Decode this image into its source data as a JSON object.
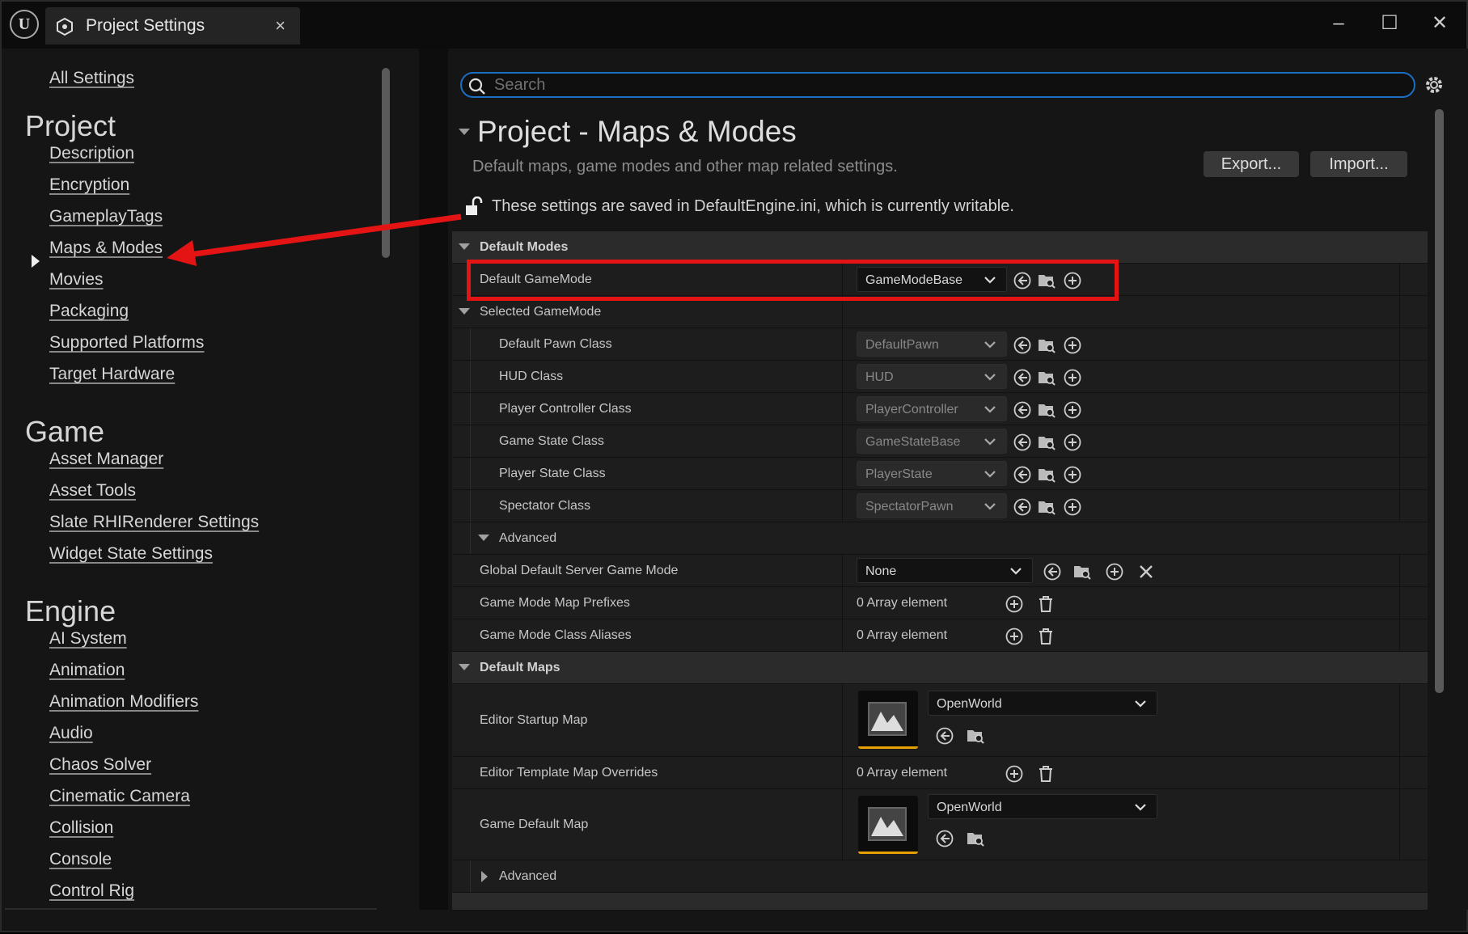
{
  "window": {
    "title": "Project Settings"
  },
  "sidebar": {
    "all_settings": "All Settings",
    "project_heading": "Project",
    "project_items": [
      "Description",
      "Encryption",
      "GameplayTags",
      "Maps & Modes",
      "Movies",
      "Packaging",
      "Supported Platforms",
      "Target Hardware"
    ],
    "game_heading": "Game",
    "game_items": [
      "Asset Manager",
      "Asset Tools",
      "Slate RHIRenderer Settings",
      "Widget State Settings"
    ],
    "engine_heading": "Engine",
    "engine_items": [
      "AI System",
      "Animation",
      "Animation Modifiers",
      "Audio",
      "Chaos Solver",
      "Cinematic Camera",
      "Collision",
      "Console",
      "Control Rig"
    ]
  },
  "search": {
    "placeholder": "Search"
  },
  "header": {
    "title": "Project - Maps & Modes",
    "description": "Default maps, game modes and other map related settings.",
    "export_label": "Export...",
    "import_label": "Import...",
    "config_notice": "These settings are saved in DefaultEngine.ini, which is currently writable."
  },
  "sections": {
    "default_modes": "Default Modes",
    "default_gamemode_label": "Default GameMode",
    "default_gamemode_value": "GameModeBase",
    "selected_gamemode": "Selected GameMode",
    "class_rows": [
      {
        "label": "Default Pawn Class",
        "value": "DefaultPawn"
      },
      {
        "label": "HUD Class",
        "value": "HUD"
      },
      {
        "label": "Player Controller Class",
        "value": "PlayerController"
      },
      {
        "label": "Game State Class",
        "value": "GameStateBase"
      },
      {
        "label": "Player State Class",
        "value": "PlayerState"
      },
      {
        "label": "Spectator Class",
        "value": "SpectatorPawn"
      }
    ],
    "advanced": "Advanced",
    "global_server_label": "Global Default Server Game Mode",
    "global_server_value": "None",
    "map_prefixes_label": "Game Mode Map Prefixes",
    "map_prefixes_value": "0 Array element",
    "class_aliases_label": "Game Mode Class Aliases",
    "class_aliases_value": "0 Array element",
    "default_maps": "Default Maps",
    "editor_startup_label": "Editor Startup Map",
    "editor_startup_value": "OpenWorld",
    "template_overrides_label": "Editor Template Map Overrides",
    "template_overrides_value": "0 Array element",
    "game_default_label": "Game Default Map",
    "game_default_value": "OpenWorld",
    "advanced2": "Advanced"
  },
  "annotation": {
    "highlight_color": "#e41414"
  },
  "colors": {
    "accent": "#1b6fc2",
    "thumbnail_bar": "#e8a000"
  }
}
